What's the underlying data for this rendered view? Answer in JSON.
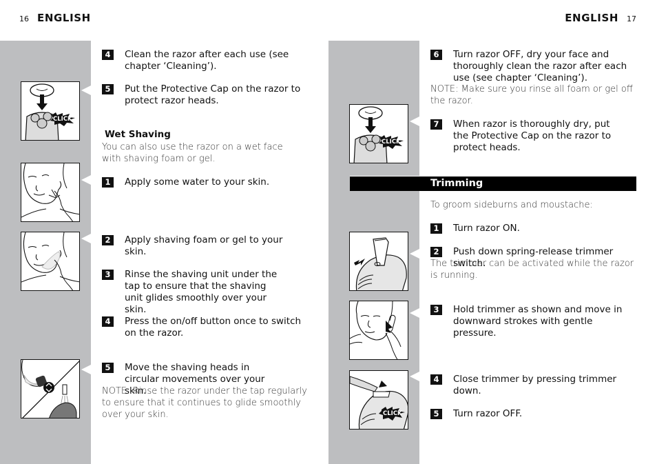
{
  "left_page": {
    "page_number": "16",
    "language": "ENGLISH",
    "steps_top": [
      {
        "num": "4",
        "text": "Clean the razor after each use (see chapter ‘Cleaning’)."
      },
      {
        "num": "5",
        "text": "Put the Protective Cap on the razor to protect razor heads."
      }
    ],
    "wet_shaving": {
      "title": "Wet Shaving",
      "intro": "You can also use the razor on a wet face with shaving foam or gel.",
      "steps": [
        {
          "num": "1",
          "text": "Apply some water to your skin."
        },
        {
          "num": "2",
          "text": "Apply shaving foam or gel to your skin."
        },
        {
          "num": "3",
          "text": "Rinse the shaving unit under the tap to ensure that the shaving unit glides smoothly over your skin."
        },
        {
          "num": "4",
          "text": "Press the on/off button once to switch on the razor."
        },
        {
          "num": "5",
          "text": "Move the shaving heads in circular movements over your skin."
        }
      ],
      "note": "NOTE: Rinse the razor under the tap regularly to ensure that it continues to glide smoothly over your skin."
    },
    "figures": [
      {
        "icon": "razor-protective-cap-icon",
        "label": "CLICK"
      },
      {
        "icon": "face-apply-water-icon"
      },
      {
        "icon": "face-apply-foam-icon"
      },
      {
        "icon": "razor-rinse-tap-icon"
      }
    ]
  },
  "right_page": {
    "page_number": "17",
    "language": "ENGLISH",
    "steps_top": [
      {
        "num": "6",
        "text": "Turn razor OFF, dry your face and thoroughly clean the razor after each use (see chapter ‘Cleaning’)."
      },
      {
        "num": "7",
        "text": "When razor is thoroughly dry, put the Protective Cap on the razor to protect heads."
      }
    ],
    "note_top": "NOTE: Make sure you rinse all foam or gel off the razor.",
    "trimming": {
      "title": "Trimming",
      "intro": "To groom sideburns and moustache:",
      "steps": [
        {
          "num": "1",
          "text": "Turn razor ON."
        },
        {
          "num": "2",
          "text": "Push down spring-release trimmer switch."
        },
        {
          "num": "3",
          "text": "Hold trimmer as shown and move in downward strokes with gentle pressure."
        },
        {
          "num": "4",
          "text": "Close trimmer by pressing trimmer down."
        },
        {
          "num": "5",
          "text": "Turn razor OFF."
        }
      ],
      "note": "The trimmer can be activated while the razor is running."
    },
    "figures": [
      {
        "icon": "razor-protective-cap-icon",
        "label": "CLICK"
      },
      {
        "icon": "trimmer-switch-icon"
      },
      {
        "icon": "trimming-sideburns-icon"
      },
      {
        "icon": "trimmer-close-icon",
        "label": "CLICK"
      }
    ]
  }
}
